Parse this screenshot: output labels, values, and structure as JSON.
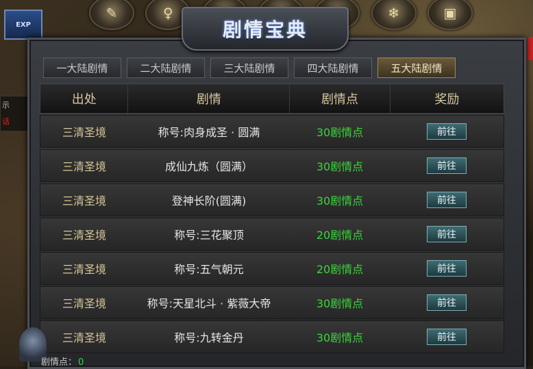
{
  "hud": {
    "exp_label": "EXP",
    "left_text_1": "示",
    "left_text_2": "话"
  },
  "panel": {
    "title": "剧情宝典",
    "tabs": [
      "一大陆剧情",
      "二大陆剧情",
      "三大陆剧情",
      "四大陆剧情",
      "五大陆剧情"
    ],
    "active_tab": 4,
    "headers": {
      "source": "出处",
      "story": "剧情",
      "points": "剧情点",
      "reward": "奖励"
    },
    "rows": [
      {
        "source": "三清圣境",
        "story": "称号:肉身成圣 · 圆满",
        "points": "30剧情点",
        "action": "前往"
      },
      {
        "source": "三清圣境",
        "story": "成仙九炼（圆满）",
        "points": "30剧情点",
        "action": "前往"
      },
      {
        "source": "三清圣境",
        "story": "登神长阶(圆满)",
        "points": "30剧情点",
        "action": "前往"
      },
      {
        "source": "三清圣境",
        "story": "称号:三花聚顶",
        "points": "20剧情点",
        "action": "前往"
      },
      {
        "source": "三清圣境",
        "story": "称号:五气朝元",
        "points": "20剧情点",
        "action": "前往"
      },
      {
        "source": "三清圣境",
        "story": "称号:天星北斗 · 紫薇大帝",
        "points": "30剧情点",
        "action": "前往"
      },
      {
        "source": "三清圣境",
        "story": "称号:九转金丹",
        "points": "30剧情点",
        "action": "前往"
      }
    ],
    "footer": {
      "label": "剧情点：",
      "value": "0"
    }
  },
  "colors": {
    "points_green": "#3ad63a",
    "source_gold": "#d8c79a",
    "active_tab": "#6a5a3a"
  }
}
